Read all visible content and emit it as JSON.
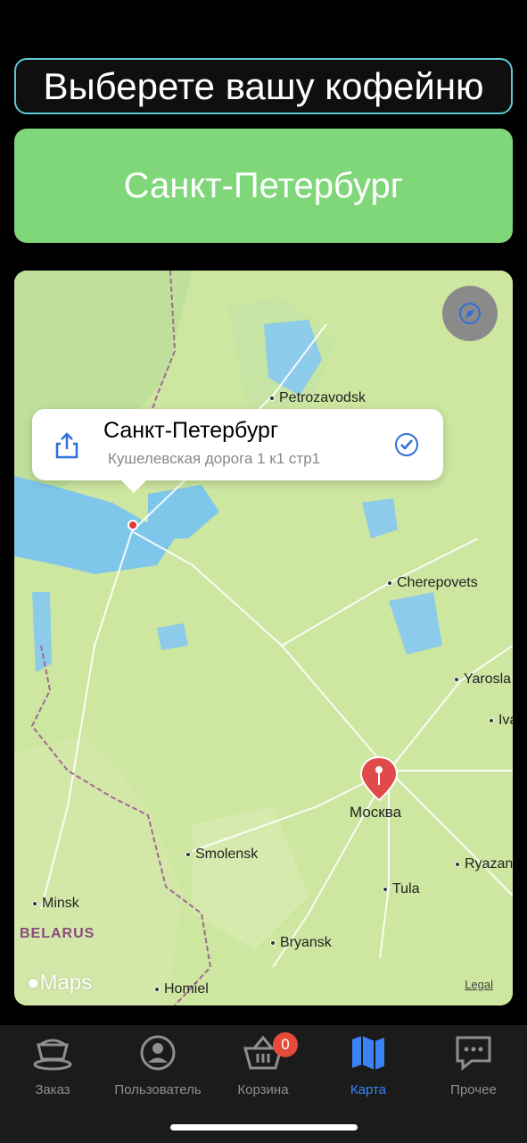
{
  "header": {
    "title": "Выберете вашу кофейню"
  },
  "city_button": {
    "label": "Санкт-Петербург"
  },
  "map": {
    "callout": {
      "title": "Санкт-Петербург",
      "address": "Кушелевская дорога 1 к1 стр1"
    },
    "places": {
      "petrozavodsk": "Petrozavodsk",
      "cherepovets": "Cherepovets",
      "yaroslavl": "Yaroslа",
      "ivanovo": "Iva",
      "moscow": "Москва",
      "smolensk": "Smolensk",
      "ryazan": "Ryazan",
      "tula": "Tula",
      "minsk": "Minsk",
      "bryansk": "Bryansk",
      "homiel": "Homiel"
    },
    "country": "BELARUS",
    "logo": "Maps",
    "legal": "Legal"
  },
  "tabbar": {
    "items": [
      {
        "label": "Заказ",
        "icon": "coffee-cup-icon"
      },
      {
        "label": "Пользователь",
        "icon": "user-icon"
      },
      {
        "label": "Корзина",
        "icon": "basket-icon",
        "badge": "0"
      },
      {
        "label": "Карта",
        "icon": "map-icon",
        "active": true
      },
      {
        "label": "Прочее",
        "icon": "chat-icon"
      }
    ]
  },
  "colors": {
    "accent": "#3b82f6",
    "city_button": "#7fd77a",
    "title_border": "#5ec8d6",
    "badge": "#e64a3b",
    "pin": "#e03a36"
  }
}
